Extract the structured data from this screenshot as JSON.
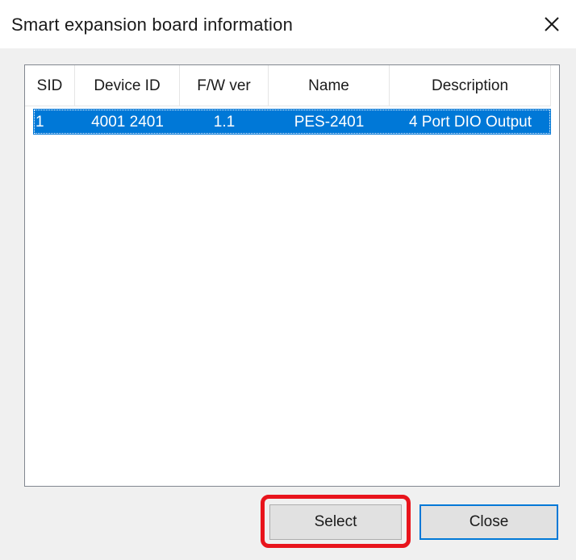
{
  "window": {
    "title": "Smart expansion board information"
  },
  "list": {
    "columns": [
      "SID",
      "Device ID",
      "F/W ver",
      "Name",
      "Description"
    ],
    "rows": [
      {
        "sid": "1",
        "device_id": "4001 2401",
        "fw_ver": "1.1",
        "name": "PES-2401",
        "description": "4 Port DIO Output",
        "selected": true
      }
    ]
  },
  "buttons": {
    "select_label": "Select",
    "close_label": "Close"
  },
  "colors": {
    "selection": "#0078d7",
    "highlight_annotation": "#e8141c",
    "dialog_background": "#f0f0f0"
  },
  "icons": {
    "close": "close-icon"
  }
}
